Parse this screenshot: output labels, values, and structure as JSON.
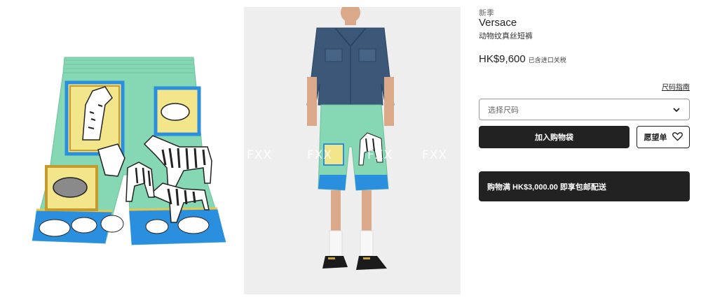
{
  "product": {
    "season": "新季",
    "brand": "Versace",
    "name": "动物纹真丝短裤",
    "price": "HK$9,600",
    "tax_note": "已含进口关税"
  },
  "size_guide_label": "尺码指南",
  "size_select": {
    "placeholder": "选择尺码"
  },
  "actions": {
    "add_to_bag": "加入购物袋",
    "wishlist": "愿望单"
  },
  "shipping_banner": "购物满 HK$3,000.00 即享包邮配送",
  "watermark_text": "FXX",
  "icons": {
    "dropdown": "chevron-down-icon",
    "wishlist": "heart-icon"
  },
  "colors": {
    "button_dark": "#222222",
    "mint": "#7fd3ad",
    "blue_band": "#2b8fe0"
  }
}
